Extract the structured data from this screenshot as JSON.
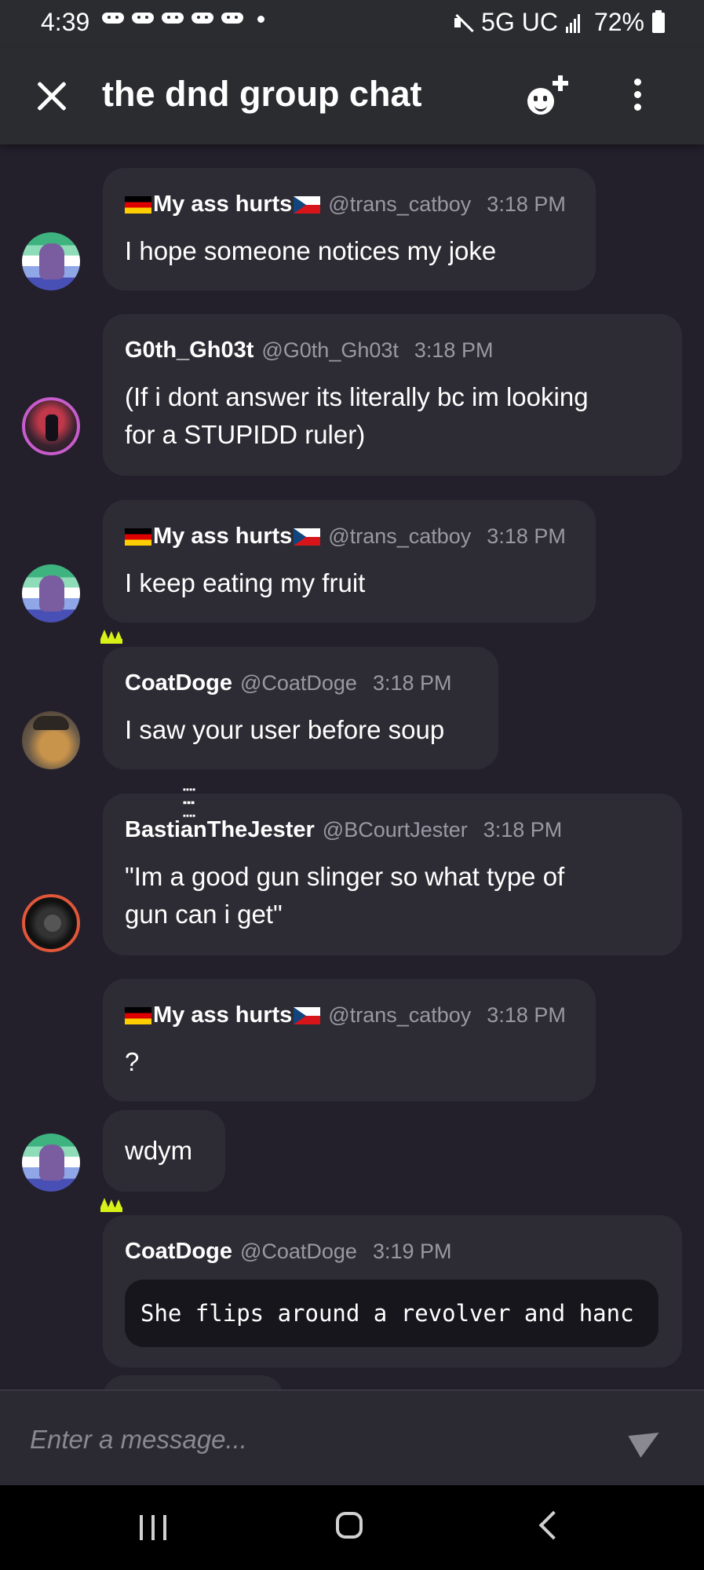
{
  "status_bar": {
    "time": "4:39",
    "network": "5G UC",
    "battery": "72%"
  },
  "header": {
    "title": "the dnd group chat",
    "icons": [
      "close-icon",
      "add-member-icon",
      "more-options-icon"
    ]
  },
  "messages": [
    {
      "name": "My ass hurts",
      "flags": [
        "flag-germany",
        "flag-czech"
      ],
      "handle": "@trans_catboy",
      "time": "3:18 PM",
      "text": "I hope someone notices my joke"
    },
    {
      "name": "G0th_Gh03t",
      "handle": "@G0th_Gh03t",
      "time": "3:18 PM",
      "text_lines": [
        "(If i dont answer its literally bc im looking",
        "for a STUPIDD ruler)"
      ]
    },
    {
      "name": "My ass hurts",
      "flags": [
        "flag-germany",
        "flag-czech"
      ],
      "handle": "@trans_catboy",
      "time": "3:18 PM",
      "text": "I keep eating my fruit"
    },
    {
      "name": "CoatDoge",
      "badge": "crown-icon",
      "handle": "@CoatDoge",
      "time": "3:18 PM",
      "text": "I saw your user before soup"
    },
    {
      "name": "BastianTheJester",
      "handle": "@BCourtJester",
      "time": "3:18 PM",
      "text_lines": [
        "\"Im a good gun slinger so what type of",
        "gun can i get\""
      ]
    },
    {
      "name": "My ass hurts",
      "flags": [
        "flag-germany",
        "flag-czech"
      ],
      "handle": "@trans_catboy",
      "time": "3:18 PM",
      "text": "?"
    },
    {
      "text": "wdym"
    },
    {
      "name": "CoatDoge",
      "badge": "crown-icon",
      "handle": "@CoatDoge",
      "time": "3:19 PM",
      "code": "She flips around a revolver and hanc"
    }
  ],
  "composer": {
    "placeholder": "Enter a message..."
  },
  "colors": {
    "background": "#23202c",
    "bubble": "#2d2c34",
    "header": "#2b2c30",
    "crown": "#d8f218",
    "muted_text": "#9a99a2"
  }
}
